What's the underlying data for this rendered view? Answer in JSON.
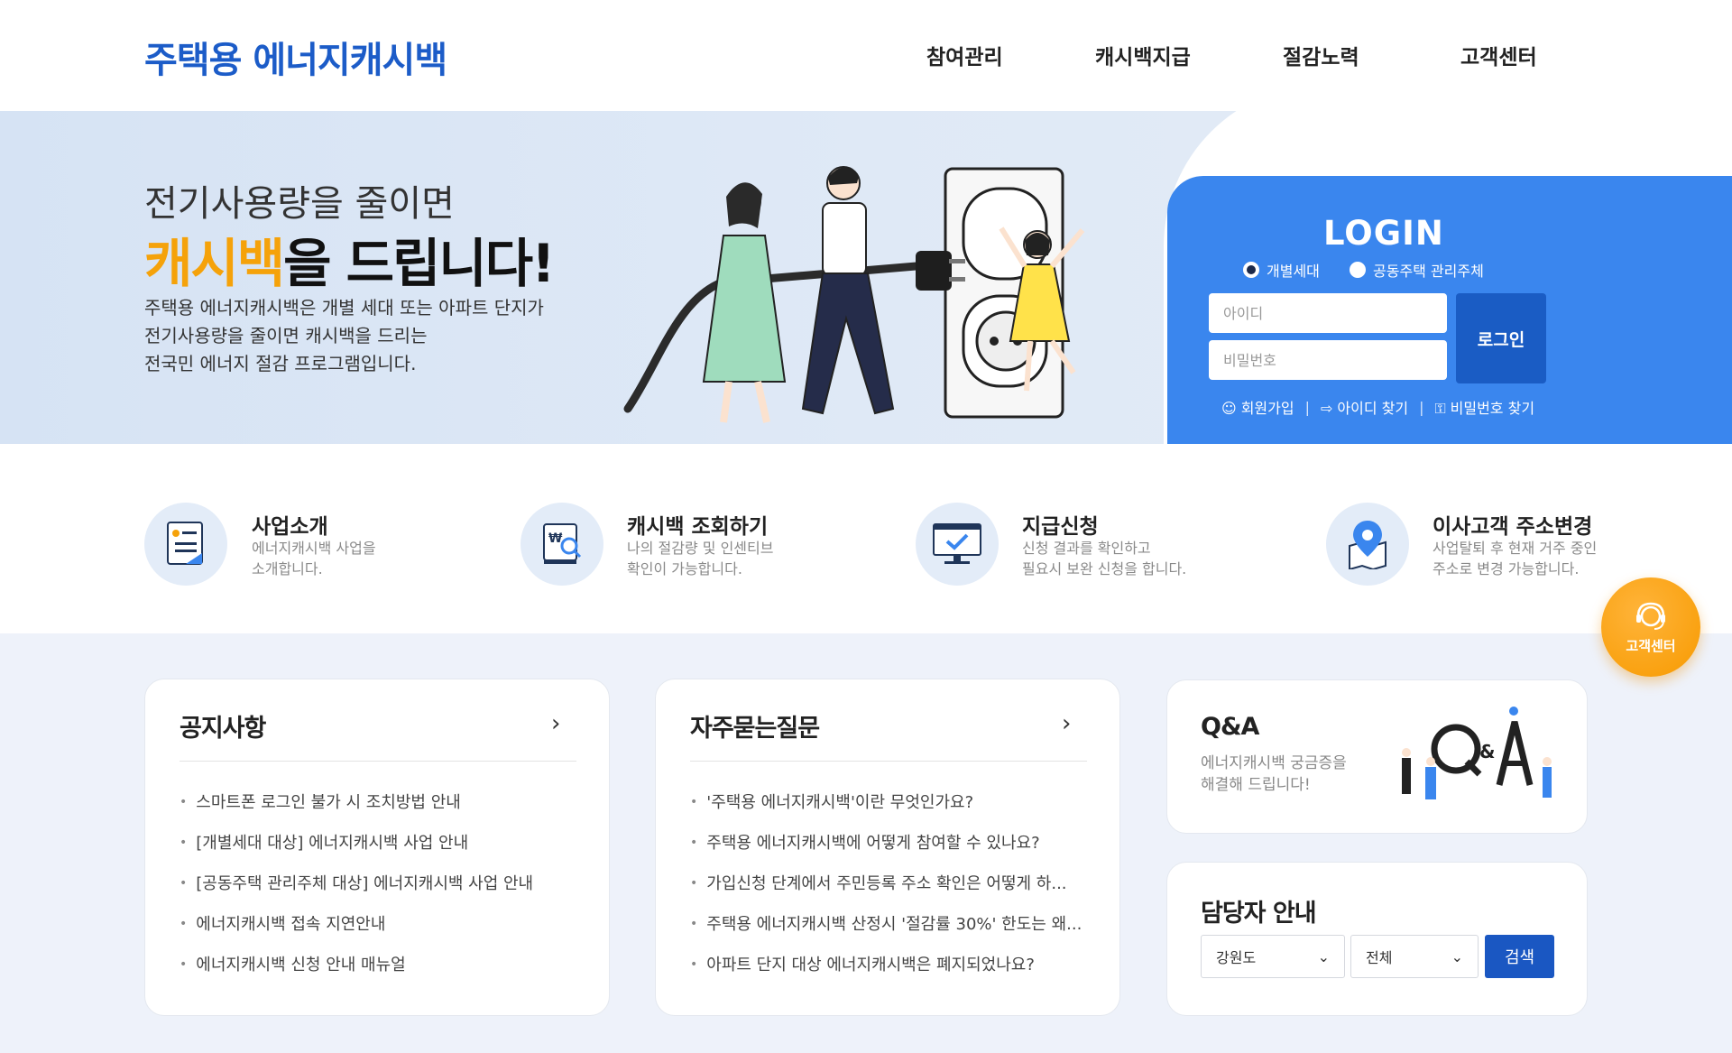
{
  "header": {
    "logo": "주택용 에너지캐시백",
    "nav": [
      "참여관리",
      "캐시백지급",
      "절감노력",
      "고객센터"
    ]
  },
  "hero": {
    "subtitle": "전기사용량을 줄이면",
    "title_accent": "캐시백",
    "title_rest": "을 드립니다!",
    "desc": [
      "주택용 에너지캐시백은 개별 세대 또는 아파트 단지가",
      "전기사용량을 줄이면 캐시백을 드리는",
      "전국민 에너지 절감 프로그램입니다."
    ]
  },
  "login": {
    "title": "LOGIN",
    "radio_1": "개별세대",
    "radio_2": "공동주택 관리주체",
    "id_placeholder": "아이디",
    "pw_placeholder": "비밀번호",
    "button": "로그인",
    "signup": "회원가입",
    "find_id": "아이디 찾기",
    "find_pw": "비밀번호 찾기"
  },
  "services": [
    {
      "title": "사업소개",
      "desc1": "에너지캐시백 사업을",
      "desc2": "소개합니다."
    },
    {
      "title": "캐시백 조회하기",
      "desc1": "나의 절감량 및 인센티브",
      "desc2": "확인이 가능합니다."
    },
    {
      "title": "지급신청",
      "desc1": "신청 결과를 확인하고",
      "desc2": "필요시 보완 신청을 합니다."
    },
    {
      "title": "이사고객 주소변경",
      "desc1": "사업탈퇴 후 현재 거주 중인",
      "desc2": "주소로 변경 가능합니다."
    }
  ],
  "notice": {
    "title": "공지사항",
    "items": [
      "스마트폰 로그인 불가 시 조치방법 안내",
      "[개별세대 대상] 에너지캐시백 사업 안내",
      "[공동주택 관리주체 대상] 에너지캐시백 사업 안내",
      "에너지캐시백 접속 지연안내",
      "에너지캐시백 신청 안내 매뉴얼"
    ]
  },
  "faq": {
    "title": "자주묻는질문",
    "items": [
      "'주택용 에너지캐시백'이란 무엇인가요?",
      "주택용 에너지캐시백에 어떻게 참여할 수 있나요?",
      "가입신청 단계에서 주민등록 주소 확인은 어떻게 하...",
      "주택용 에너지캐시백 산정시 '절감률 30%' 한도는 왜...",
      "아파트 단지 대상 에너지캐시백은 폐지되었나요?"
    ]
  },
  "qa": {
    "title": "Q&A",
    "desc1": "에너지캐시백 궁금증을",
    "desc2": "해결해 드립니다!"
  },
  "manager": {
    "title": "담당자 안내",
    "region": "강원도",
    "scope": "전체",
    "button": "검색"
  },
  "float_cs": "고객센터",
  "colors": {
    "brand": "#1c5cc8",
    "accent": "#f5a20a",
    "login_bg": "#3a86ee",
    "button": "#1a57c2"
  }
}
